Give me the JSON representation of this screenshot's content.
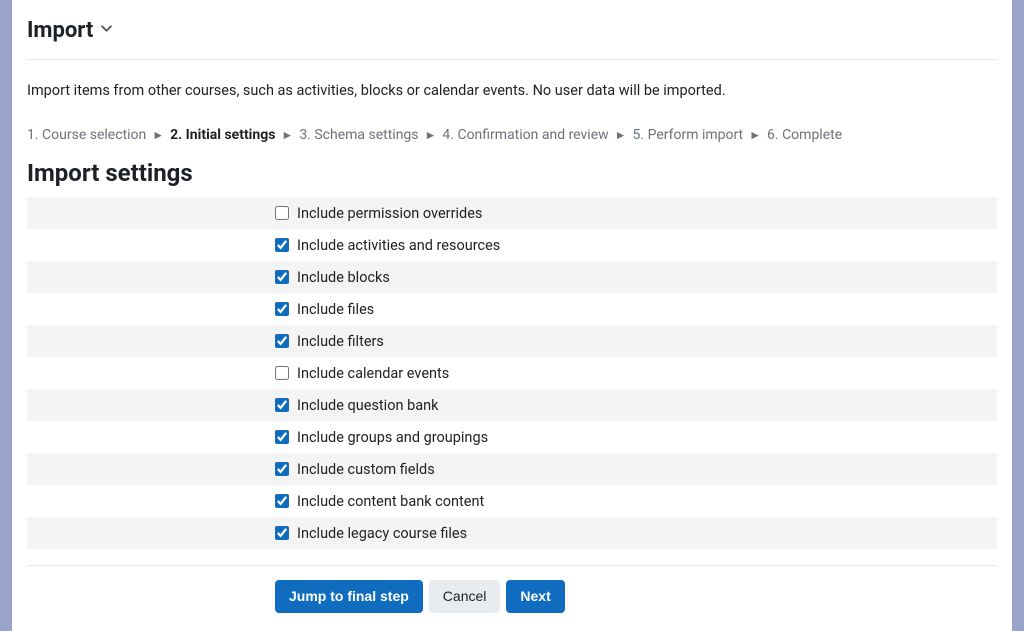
{
  "header": {
    "title": "Import"
  },
  "description": "Import items from other courses, such as activities, blocks or calendar events. No user data will be imported.",
  "steps": [
    {
      "label": "1. Course selection",
      "current": false
    },
    {
      "label": "2. Initial settings",
      "current": true
    },
    {
      "label": "3. Schema settings",
      "current": false
    },
    {
      "label": "4. Confirmation and review",
      "current": false
    },
    {
      "label": "5. Perform import",
      "current": false
    },
    {
      "label": "6. Complete",
      "current": false
    }
  ],
  "section_title": "Import settings",
  "settings": [
    {
      "label": "Include permission overrides",
      "checked": false
    },
    {
      "label": "Include activities and resources",
      "checked": true
    },
    {
      "label": "Include blocks",
      "checked": true
    },
    {
      "label": "Include files",
      "checked": true
    },
    {
      "label": "Include filters",
      "checked": true
    },
    {
      "label": "Include calendar events",
      "checked": false
    },
    {
      "label": "Include question bank",
      "checked": true
    },
    {
      "label": "Include groups and groupings",
      "checked": true
    },
    {
      "label": "Include custom fields",
      "checked": true
    },
    {
      "label": "Include content bank content",
      "checked": true
    },
    {
      "label": "Include legacy course files",
      "checked": true
    }
  ],
  "buttons": {
    "jump": "Jump to final step",
    "cancel": "Cancel",
    "next": "Next"
  }
}
